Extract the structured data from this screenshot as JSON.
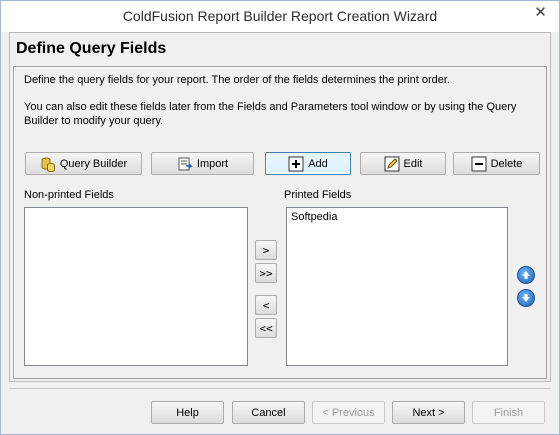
{
  "window": {
    "title": "ColdFusion Report Builder Report Creation Wizard",
    "close_glyph": "✕"
  },
  "page": {
    "title": "Define Query Fields",
    "desc1": "Define the query fields for your report. The order of the fields determines the print order.",
    "desc2": "You can also edit these fields later from the Fields and Parameters tool window or by using the Query Builder to modify your query."
  },
  "toolbar": {
    "query_builder": "Query Builder",
    "import": "Import",
    "add": "Add",
    "edit": "Edit",
    "delete": "Delete"
  },
  "lists": {
    "non_printed_label": "Non-printed Fields",
    "printed_label": "Printed Fields",
    "non_printed_items": [],
    "printed_items": [
      "Softpedia"
    ]
  },
  "transfer": {
    "move_right": ">",
    "move_all_right": ">>",
    "move_left": "<",
    "move_all_left": "<<"
  },
  "footer": {
    "help": "Help",
    "cancel": "Cancel",
    "previous": "< Previous",
    "next": "Next >",
    "finish": "Finish"
  },
  "icons": {
    "query_builder": "database-icon",
    "import": "import-icon",
    "add": "plus-icon",
    "edit": "pencil-icon",
    "delete": "minus-icon",
    "move_up": "arrow-up-icon",
    "move_down": "arrow-down-icon"
  }
}
